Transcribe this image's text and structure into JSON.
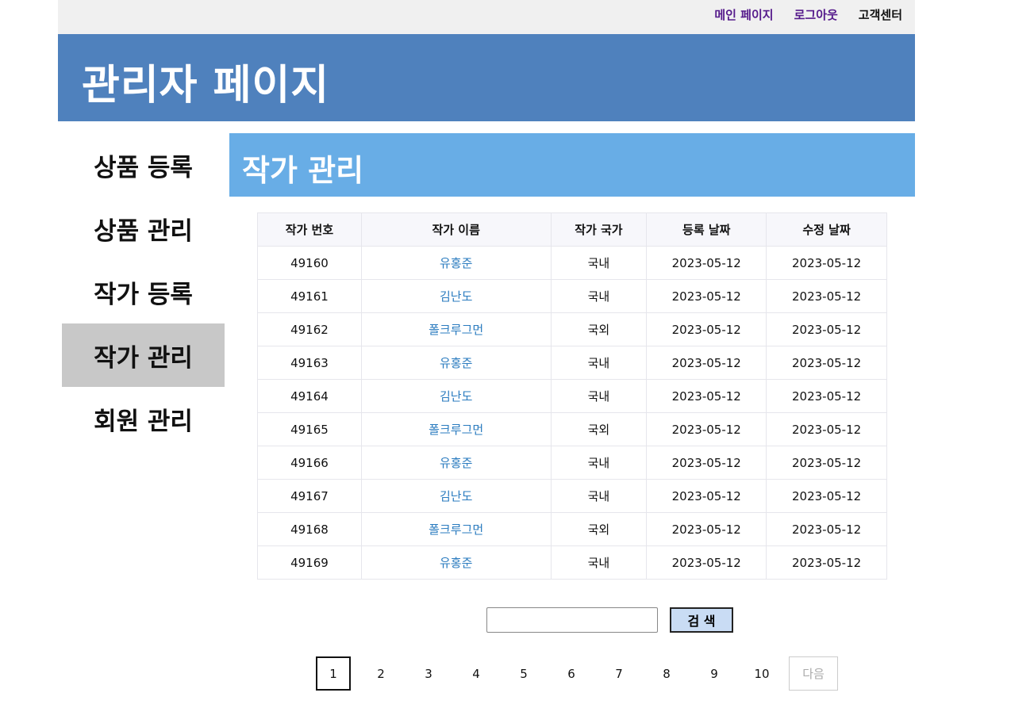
{
  "topbar": {
    "links": [
      "메인 페이지",
      "로그아웃",
      "고객센터"
    ]
  },
  "header": {
    "title": "관리자 페이지"
  },
  "sidebar": {
    "items": [
      "상품 등록",
      "상품 관리",
      "작가 등록",
      "작가 관리",
      "회원 관리"
    ],
    "active": "작가 관리"
  },
  "section": {
    "title": "작가 관리"
  },
  "table": {
    "headers": [
      "작가 번호",
      "작가 이름",
      "작가 국가",
      "등록 날짜",
      "수정 날짜"
    ],
    "rows": [
      [
        "49160",
        "유홍준",
        "국내",
        "2023-05-12",
        "2023-05-12"
      ],
      [
        "49161",
        "김난도",
        "국내",
        "2023-05-12",
        "2023-05-12"
      ],
      [
        "49162",
        "폴크루그먼",
        "국외",
        "2023-05-12",
        "2023-05-12"
      ],
      [
        "49163",
        "유홍준",
        "국내",
        "2023-05-12",
        "2023-05-12"
      ],
      [
        "49164",
        "김난도",
        "국내",
        "2023-05-12",
        "2023-05-12"
      ],
      [
        "49165",
        "폴크루그먼",
        "국외",
        "2023-05-12",
        "2023-05-12"
      ],
      [
        "49166",
        "유홍준",
        "국내",
        "2023-05-12",
        "2023-05-12"
      ],
      [
        "49167",
        "김난도",
        "국내",
        "2023-05-12",
        "2023-05-12"
      ],
      [
        "49168",
        "폴크루그먼",
        "국외",
        "2023-05-12",
        "2023-05-12"
      ],
      [
        "49169",
        "유홍준",
        "국내",
        "2023-05-12",
        "2023-05-12"
      ]
    ]
  },
  "search": {
    "value": "",
    "placeholder": "",
    "button_label": "검 색"
  },
  "pagination": {
    "pages": [
      "1",
      "2",
      "3",
      "4",
      "5",
      "6",
      "7",
      "8",
      "9",
      "10"
    ],
    "current": "1",
    "next_label": "다음"
  },
  "colors": {
    "header_bg": "#4f81bd",
    "section_title_bg": "#68ade6",
    "sidebar_active_bg": "#c8c8c8",
    "link_blue": "#2a7bbf",
    "visited_purple": "#551a8b"
  }
}
